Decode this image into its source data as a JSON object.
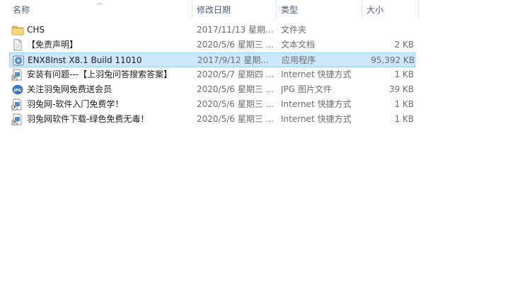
{
  "columns": {
    "name": "名称",
    "date": "修改日期",
    "type": "类型",
    "size": "大小"
  },
  "files": [
    {
      "name": "CHS",
      "date": "2017/11/13 星期...",
      "type": "文件夹",
      "size": "",
      "icon": "folder-icon",
      "selected": false
    },
    {
      "name": "【免责声明】",
      "date": "2020/5/6 星期三 ...",
      "type": "文本文档",
      "size": "2 KB",
      "icon": "text-document-icon",
      "selected": false
    },
    {
      "name": "ENX8Inst X8.1 Build 11010",
      "date": "2017/9/12 星期...",
      "type": "应用程序",
      "size": "95,392 KB",
      "icon": "installer-icon",
      "selected": true
    },
    {
      "name": "安装有问题---【上羽兔问答搜索答案】",
      "date": "2020/5/7 星期四 ...",
      "type": "Internet 快捷方式",
      "size": "1 KB",
      "icon": "internet-shortcut-icon",
      "selected": false
    },
    {
      "name": "关注羽兔网免费送会员",
      "date": "2020/5/6 星期三 ...",
      "type": "JPG 图片文件",
      "size": "39 KB",
      "icon": "jpg-image-icon",
      "selected": false
    },
    {
      "name": "羽兔网-软件入门免费学！",
      "date": "2020/5/6 星期三 ...",
      "type": "Internet 快捷方式",
      "size": "1 KB",
      "icon": "internet-shortcut-icon",
      "selected": false
    },
    {
      "name": "羽兔网软件下载-绿色免费无毒！",
      "date": "2020/5/6 星期三 ...",
      "type": "Internet 快捷方式",
      "size": "1 KB",
      "icon": "internet-shortcut-icon",
      "selected": false
    }
  ]
}
